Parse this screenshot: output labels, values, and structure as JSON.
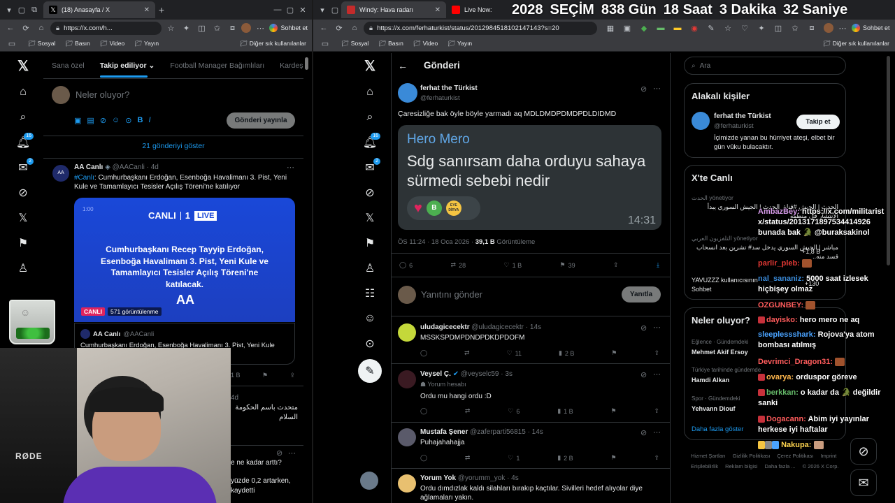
{
  "left_window": {
    "tab_title": "(18) Anasayfa / X",
    "url": "https://x.com/h...",
    "sohbet": "Sohbet et",
    "bookmarks": [
      "Sosyal",
      "Basın",
      "Video",
      "Yayın"
    ],
    "other_bookmarks": "Diğer sık kullanılanlar",
    "feed_tabs": [
      "Sana özel",
      "Takip ediliyor",
      "Football Manager Bağımlıları",
      "Kardeşl"
    ],
    "compose_placeholder": "Neler oluyor?",
    "post_button": "Gönderi yayınla",
    "show_posts": "21 gönderiyi göster",
    "notif_badge": "16",
    "msg_badge": "2",
    "post1": {
      "name": "AA Canlı",
      "handle": "@AACanli · 4d",
      "hashtag": "#Canlı",
      "text": ": Cumhurbaşkanı Erdoğan, Esenboğa Havalimanı 3. Pist, Yeni Kule ve Tamamlayıcı Tesisler Açılış Töreni'ne katılıyor",
      "media_canli": "CANLI",
      "media_num": "1",
      "media_live": "LIVE",
      "media_text": "Cumhurbaşkanı Recep Tayyip Erdoğan, Esenboğa Havalimanı 3. Pist, Yeni Kule ve Tamamlayıcı Tesisler Açılış Töreni'ne katılacak.",
      "media_time": "1:00",
      "live_badge": "CANLI",
      "views": "571 görüntülenme",
      "quote_name": "AA Canlı",
      "quote_handle": "@AACanli",
      "quote_text": "Cumhurbaşkanı Erdoğan, Esenboğa Havalimanı 3. Pist, Yeni Kule"
    },
    "post1_count": "1 B",
    "post2_num": "4d",
    "arabic1": "متحدث باسم الحكومة",
    "arabic2": "السلام",
    "partial1": "e ne kadar arttı?",
    "partial2": "yüzde 0,2 artarken,",
    "partial3": "kaydetti"
  },
  "right_window": {
    "tab1": "Windy: Hava radarı",
    "tab2": "Live Now:",
    "url": "https://x.com/ferhaturkist/status/2012984518102147143?s=20",
    "sohbet": "Sohbet et",
    "bookmarks": [
      "Sosyal",
      "Basın",
      "Video",
      "Yayın"
    ],
    "other_bookmarks": "Diğer sık kullanılanlar",
    "header": "Gönderi",
    "notif_badge": "16",
    "msg_badge": "2",
    "main_post": {
      "name": "ferhat the Türkist",
      "handle": "@ferhaturkist",
      "text": "Çaresizliğe bak öyle böyle yarmadı aq MDLDMDPDMDPDLDIDMD",
      "quote_title": "Hero Mero",
      "quote_text": "Sdg sanırsam daha orduyu sahaya sürmedi sebebi nedir",
      "quote_time": "14:31",
      "quote_b": "B",
      "quote_eye": "EYE DİRYA",
      "meta_time": "ÖS 11:24 · 18 Oca 2026 · ",
      "meta_views": "39,1 B",
      "meta_views_label": " Görüntüleme",
      "replies": "6",
      "reposts": "28",
      "likes": "1 B",
      "bookmarks": "39"
    },
    "reply_placeholder": "Yanıtını gönder",
    "reply_button": "Yanıtla",
    "replies": [
      {
        "name": "uludagicecektr",
        "handle": "@uludagicecektr · 14s",
        "text": "MSSKSPDMPDNDPDKDPDOFM",
        "sub": "",
        "c1": "",
        "c2": "",
        "c3": "11",
        "c4": "2 B",
        "avatar": "#c4d83a"
      },
      {
        "name": "Veysel Ç.",
        "handle": "@veyselc59 · 3s",
        "text": "Ordu mu hangi ordu :D",
        "sub": "Yorum hesabı",
        "c1": "",
        "c2": "",
        "c3": "6",
        "c4": "1 B",
        "avatar": "#3a1a22"
      },
      {
        "name": "Mustafa Şener",
        "handle": "@zaferparti56815 · 14s",
        "text": "Puhajahahajja",
        "sub": "",
        "c1": "",
        "c2": "",
        "c3": "1",
        "c4": "2 B",
        "avatar": "#5a5a6a"
      },
      {
        "name": "Yorum Yok",
        "handle": "@yorumm_yok · 4s",
        "text": "Ordu dımdızlak kaldı silahları bırakıp kaçtılar. Sivilleri hedef alıyolar diye ağlamaları yakın.",
        "sub": "",
        "c1": "",
        "c2": "",
        "c3": "",
        "c4": "",
        "avatar": "#e8c070"
      }
    ],
    "search_placeholder": "Ara",
    "related_title": "Alakalı kişiler",
    "related": {
      "name": "ferhat the Türkist",
      "handle": "@ferhaturkist",
      "bio": "İçimizde yanan bu hürriyet ateşi, elbet bir gün vûku bulacaktır.",
      "follow": "Takip et"
    },
    "live_title": "X'te Canlı",
    "live_items": [
      {
        "src": "الحدث",
        "role": "yönetiyor",
        "text": "الحدث | الجيش #قناة_الحدث | الجيش السوري يبدأ الانتشار في منطقة"
      },
      {
        "src": "التلفزيون العربي",
        "role": "yönetiyor",
        "text": "مباشر | الجيش السوري يدخل سد# تشرين بعد انسحاب قسد منه.."
      },
      {
        "src": "",
        "role": "",
        "text": "YAVUZZZ kullanıcısının Sohbet"
      }
    ],
    "live_counts": [
      "+1,8 B",
      "+130"
    ],
    "trends_title": "Neler oluyor?",
    "trends": [
      {
        "cat": "Eğlence · Gündemdeki",
        "name": "Mehmet Akif Ersoy"
      },
      {
        "cat": "Türkiye tarihinde gündemde",
        "name": "Hamdi Alkan"
      },
      {
        "cat": "Spor · Gündemdeki",
        "name": "Yehvann Diouf"
      }
    ],
    "trends_more": "Daha fazla göster",
    "footer": [
      "Hizmet Şartları",
      "Gizlilik Politikası",
      "Çerez Politikası",
      "Imprint",
      "Erişilebilirlik",
      "Reklam bilgisi",
      "Daha fazla ...",
      "© 2026 X Corp."
    ]
  },
  "countdown": {
    "year": "2028",
    "label": "SEÇİM",
    "days": "838 Gün",
    "hours": "18 Saat",
    "minutes": "3 Dakika",
    "seconds": "32 Saniye"
  },
  "chat": [
    {
      "user": "AmbazBey:",
      "msg": "https://x.com/militarist x/status/2013171897534414926 bunada bak 🐊 @buraksakinol"
    },
    {
      "user": "parlir_pleb:",
      "msg": ""
    },
    {
      "user": "nal_sananiz:",
      "msg": "5000 saat izlesek hiçbişey olmaz"
    },
    {
      "user": "OZGUNBEY:",
      "msg": ""
    },
    {
      "user": "dayisko:",
      "msg": "hero mero ne aq"
    },
    {
      "user": "sleeplessshark:",
      "msg": "Rojova'ya atom bombası atılmış"
    },
    {
      "user": "Devrimci_Dragon31:",
      "msg": ""
    },
    {
      "user": "ovarya:",
      "msg": "orduspor göreve"
    },
    {
      "user": "berkkan:",
      "msg": "o kadar da 🐊 değildir sanki"
    },
    {
      "user": "Dogacann:",
      "msg": "Abim iyi yayınlar herkese iyi haftalar"
    },
    {
      "user": "Nakupa:",
      "msg": ""
    }
  ],
  "webcam_label": "RØDE",
  "colors": {
    "accent": "#1d9bf0",
    "x_bg": "#000000",
    "chrome_dark": "#202124",
    "chrome_mid": "#3a3b3f",
    "live_red": "#e0245e"
  }
}
